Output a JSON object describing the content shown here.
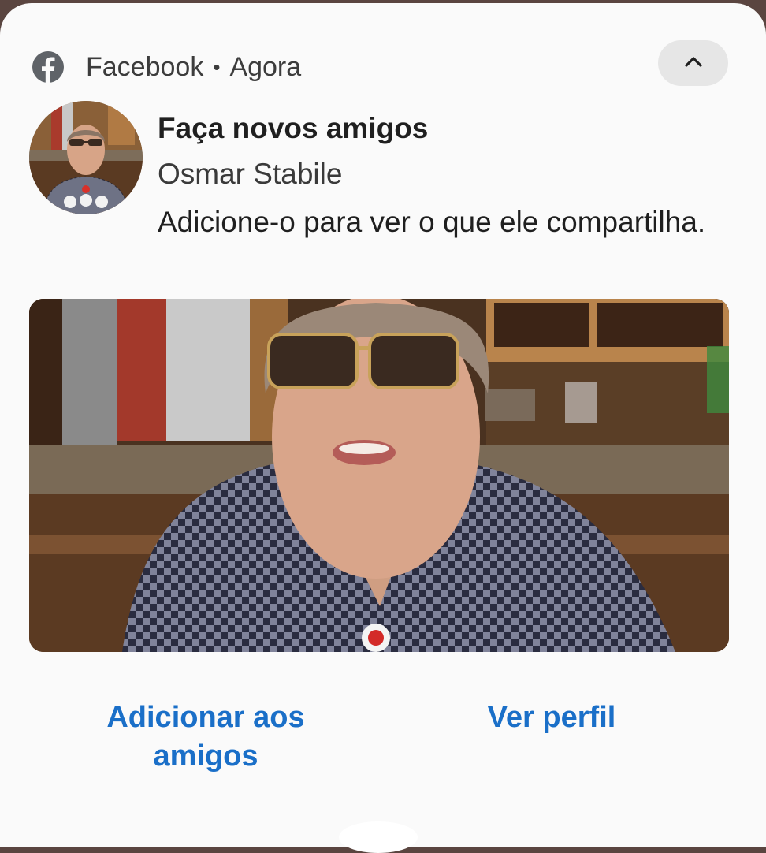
{
  "notification": {
    "app_name": "Facebook",
    "separator": "•",
    "time": "Agora",
    "app_icon": "facebook-icon",
    "collapse_icon": "chevron-up-icon",
    "title": "Faça novos amigos",
    "person_name": "Osmar Stabile",
    "message": "Adicione-o para ver o que ele compartilha."
  },
  "actions": {
    "add_friend_label": "Adicionar aos amigos",
    "view_profile_label": "Ver perfil"
  },
  "colors": {
    "accent": "#1a6fc8",
    "card_background": "#fafafa",
    "text_primary": "#1f1f1f"
  }
}
